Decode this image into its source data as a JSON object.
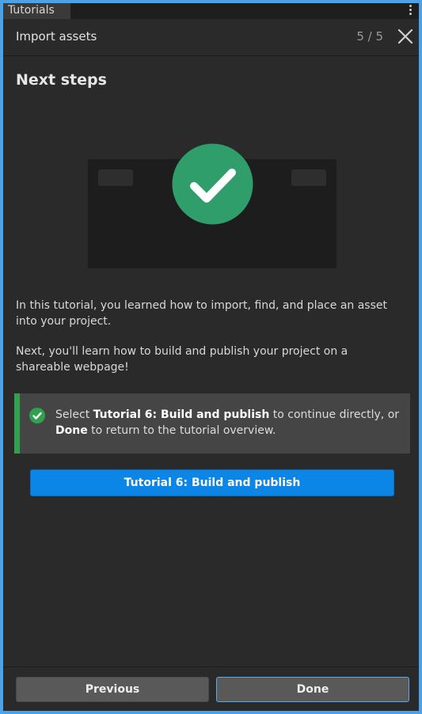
{
  "window": {
    "tab_label": "Tutorials"
  },
  "header": {
    "title": "Import assets",
    "step": "5 / 5"
  },
  "content": {
    "title": "Next steps",
    "paragraph1": "In this tutorial, you learned how to import, find, and place an asset into your project.",
    "paragraph2": "Next, you'll learn how to build and publish your project on a shareable webpage!",
    "callout": {
      "prefix": "Select ",
      "bold1": "Tutorial 6: Build and publish",
      "middle": " to continue directly, or ",
      "bold2": "Done",
      "suffix": " to return to the tutorial overview."
    },
    "primary_button": "Tutorial 6: Build and publish"
  },
  "footer": {
    "previous_label": "Previous",
    "done_label": "Done"
  },
  "colors": {
    "accent_blue": "#0b85e6",
    "success_green": "#2f9e6a",
    "callout_border": "#2fa14f",
    "panel_bg": "#2a2a2a"
  },
  "icons": {
    "close": "close-icon",
    "menu": "kebab-menu-icon",
    "success": "checkmark-circle-icon"
  }
}
